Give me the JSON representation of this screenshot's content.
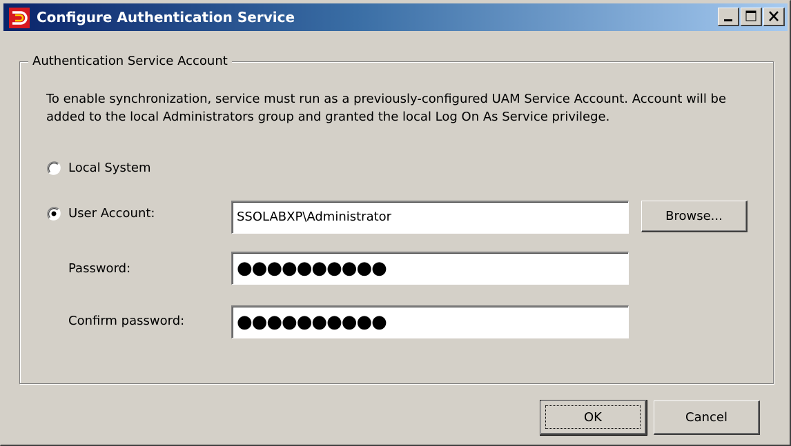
{
  "window": {
    "title": "Configure Authentication Service",
    "colors": {
      "titlebar_start": "#0a246a",
      "titlebar_end": "#a6caf0",
      "face": "#d4d0c8"
    },
    "icon": "app-logo-icon"
  },
  "groupbox": {
    "legend": "Authentication Service Account",
    "description": "To enable synchronization, service must run as a previously-configured UAM Service Account. Account will be added to the local Administrators group and granted the local Log On As Service privilege."
  },
  "radios": {
    "local_system": {
      "label": "Local System",
      "selected": false
    },
    "user_account": {
      "label": "User Account:",
      "selected": true
    }
  },
  "fields": {
    "user_account_value": "SSOLABXP\\Administrator",
    "password_label": "Password:",
    "password_value": "●●●●●●●●●●",
    "confirm_label": "Confirm password:",
    "confirm_value": "●●●●●●●●●●"
  },
  "buttons": {
    "browse": "Browse...",
    "ok": "OK",
    "cancel": "Cancel"
  }
}
